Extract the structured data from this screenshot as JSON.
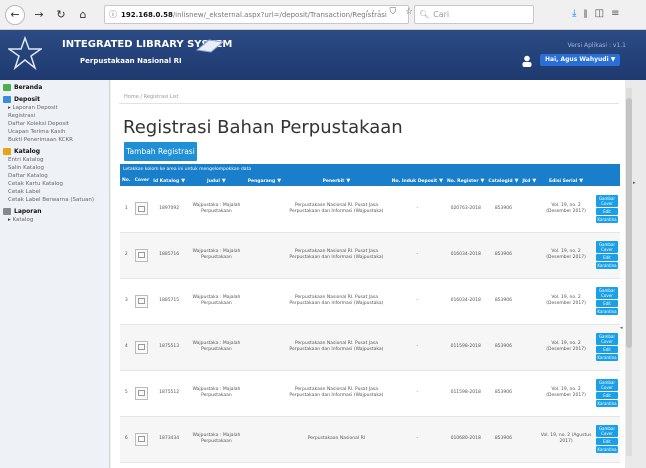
{
  "browser": {
    "url_host": "192.168.0.58",
    "url_path": "/inlisnew/_eksternal.aspx?url=/deposit/Transaction/Registrasi",
    "url_actions": "··· ⛉ ☆",
    "search_placeholder": "Cari"
  },
  "app": {
    "title": "INTEGRATED LIBRARY SYSTEM",
    "subtitle": "Perpustakaan Nasional RI",
    "version": "Versi Aplikasi : v1.1",
    "user": "Hai, Agus Wahyudi ▼"
  },
  "sidebar": {
    "sections": [
      {
        "title": "Beranda",
        "color": "#4caf50",
        "items": []
      },
      {
        "title": "Deposit",
        "color": "#3c8cd8",
        "items": [
          {
            "label": "Laporan Deposit",
            "arrow": true
          },
          {
            "label": "Registrasi",
            "arrow": false
          },
          {
            "label": "Daftar Koleksi Deposit",
            "arrow": false
          },
          {
            "label": "Ucapan Terima Kasih",
            "arrow": false
          },
          {
            "label": "Bukti Penerimaan KCKR",
            "arrow": false
          }
        ]
      },
      {
        "title": "Katalog",
        "color": "#e8a317",
        "items": [
          {
            "label": "Entri Katalog",
            "arrow": false
          },
          {
            "label": "Salin Katalog",
            "arrow": false
          },
          {
            "label": "Daftar Katalog",
            "arrow": false
          },
          {
            "label": "Cetak Kartu Katalog",
            "arrow": false
          },
          {
            "label": "Cetak Label",
            "arrow": false
          },
          {
            "label": "Cetak Label Berwarna (Satuan)",
            "arrow": false
          }
        ]
      },
      {
        "title": "Laporan",
        "color": "#888888",
        "items": [
          {
            "label": "Katalog",
            "arrow": true
          }
        ]
      }
    ]
  },
  "main": {
    "breadcrumb": "Home  /  Registrasi List",
    "title": "Registrasi Bahan Perpustakaan",
    "add_button": "Tambah Registrasi",
    "hint": "Letakkan kolom ke area ini untuk mengelompokkan data"
  },
  "table": {
    "headers": [
      "No.",
      "Cover",
      "Id Katalog",
      "Judul",
      "Pengarang",
      "Penerbit",
      "No. Induk Deposit",
      "No. Register",
      "Catalogid",
      "Jkd",
      "Edisi Serial"
    ],
    "actions": [
      "Gambar Cover",
      "Edit",
      "Karantina"
    ],
    "rows": [
      {
        "no": "1",
        "id": "1897092",
        "judul": "Wajpustaka : Majalah Perpustakaan",
        "penerbit": "Perpustakaan Nasional RI. Pusat Jasa Perpustakaan dan Informasi (Wajpustaka)",
        "induk": "-",
        "register": "020763-2018",
        "catalogid": "853906",
        "jkd": "",
        "edisi": "Vol. 19, no. 2 (Desember 2017)"
      },
      {
        "no": "2",
        "id": "1885716",
        "judul": "Wajpustaka : Majalah Perpustakaan",
        "penerbit": "Perpustakaan Nasional RI. Pusat Jasa Perpustakaan dan Informasi (Wajpustaka)",
        "induk": "-",
        "register": "016034-2018",
        "catalogid": "853906",
        "jkd": "",
        "edisi": "Vol. 19, no. 2 (Desember 2017)"
      },
      {
        "no": "3",
        "id": "1885715",
        "judul": "Wajpustaka : Majalah Perpustakaan",
        "penerbit": "Perpustakaan Nasional RI. Pusat Jasa Perpustakaan dan Informasi (Wajpustaka)",
        "induk": "-",
        "register": "016034-2018",
        "catalogid": "853906",
        "jkd": "",
        "edisi": "Vol. 19, no. 2 (Desember 2017)"
      },
      {
        "no": "4",
        "id": "1875513",
        "judul": "Wajpustaka : Majalah Perpustakaan",
        "penerbit": "Perpustakaan Nasional RI. Pusat Jasa Perpustakaan dan Informasi (Wajpustaka)",
        "induk": "-",
        "register": "011598-2018",
        "catalogid": "853906",
        "jkd": "",
        "edisi": "Vol. 19, no. 2 (Desember 2017)"
      },
      {
        "no": "5",
        "id": "1875512",
        "judul": "Wajpustaka : Majalah Perpustakaan",
        "penerbit": "Perpustakaan Nasional RI. Pusat Jasa Perpustakaan dan Informasi (Wajpustaka)",
        "induk": "-",
        "register": "011598-2018",
        "catalogid": "853906",
        "jkd": "",
        "edisi": "Vol. 19, no. 2 (Desember 2017)"
      },
      {
        "no": "6",
        "id": "1873434",
        "judul": "Wajpustaka : Majalah Perpustakaan",
        "penerbit": "Perpustakaan Nasional RI",
        "induk": "-",
        "register": "010680-2018",
        "catalogid": "853906",
        "jkd": "",
        "edisi": "Vol. 19, no. 2 (Agustus 2017)"
      }
    ]
  }
}
